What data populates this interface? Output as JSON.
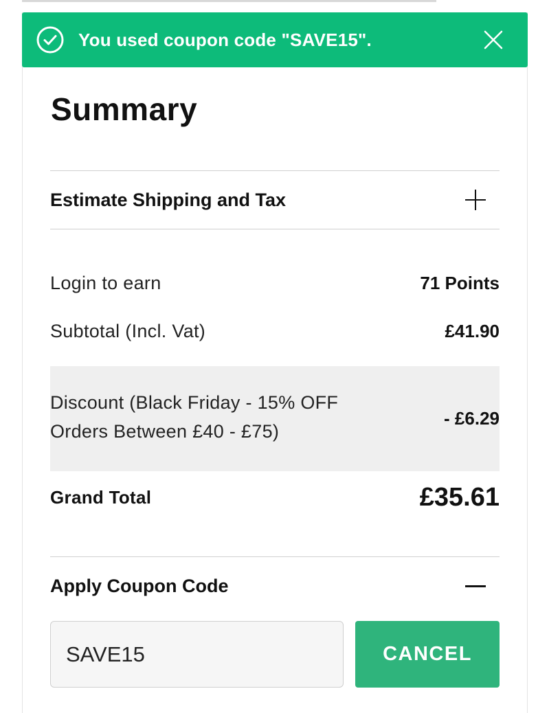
{
  "banner": {
    "message": "You used coupon code \"SAVE15\".",
    "icon": "check-circle-icon",
    "close_icon": "close-icon",
    "color": "#0dbb7a"
  },
  "summary": {
    "title": "Summary"
  },
  "shipping": {
    "label": "Estimate Shipping and Tax",
    "icon": "plus-icon"
  },
  "totals": {
    "points_label": "Login to earn",
    "points_value": "71 Points",
    "subtotal_label": "Subtotal (Incl. Vat)",
    "subtotal_value": "£41.90",
    "discount_label": "Discount (Black Friday - 15% OFF Orders Between £40 - £75)",
    "discount_value": "- £6.29",
    "grand_total_label": "Grand Total",
    "grand_total_value": "£35.61"
  },
  "coupon": {
    "label": "Apply Coupon Code",
    "icon": "minus-icon",
    "input_value": "SAVE15",
    "button_label": "CANCEL",
    "button_color": "#2fb47c"
  }
}
